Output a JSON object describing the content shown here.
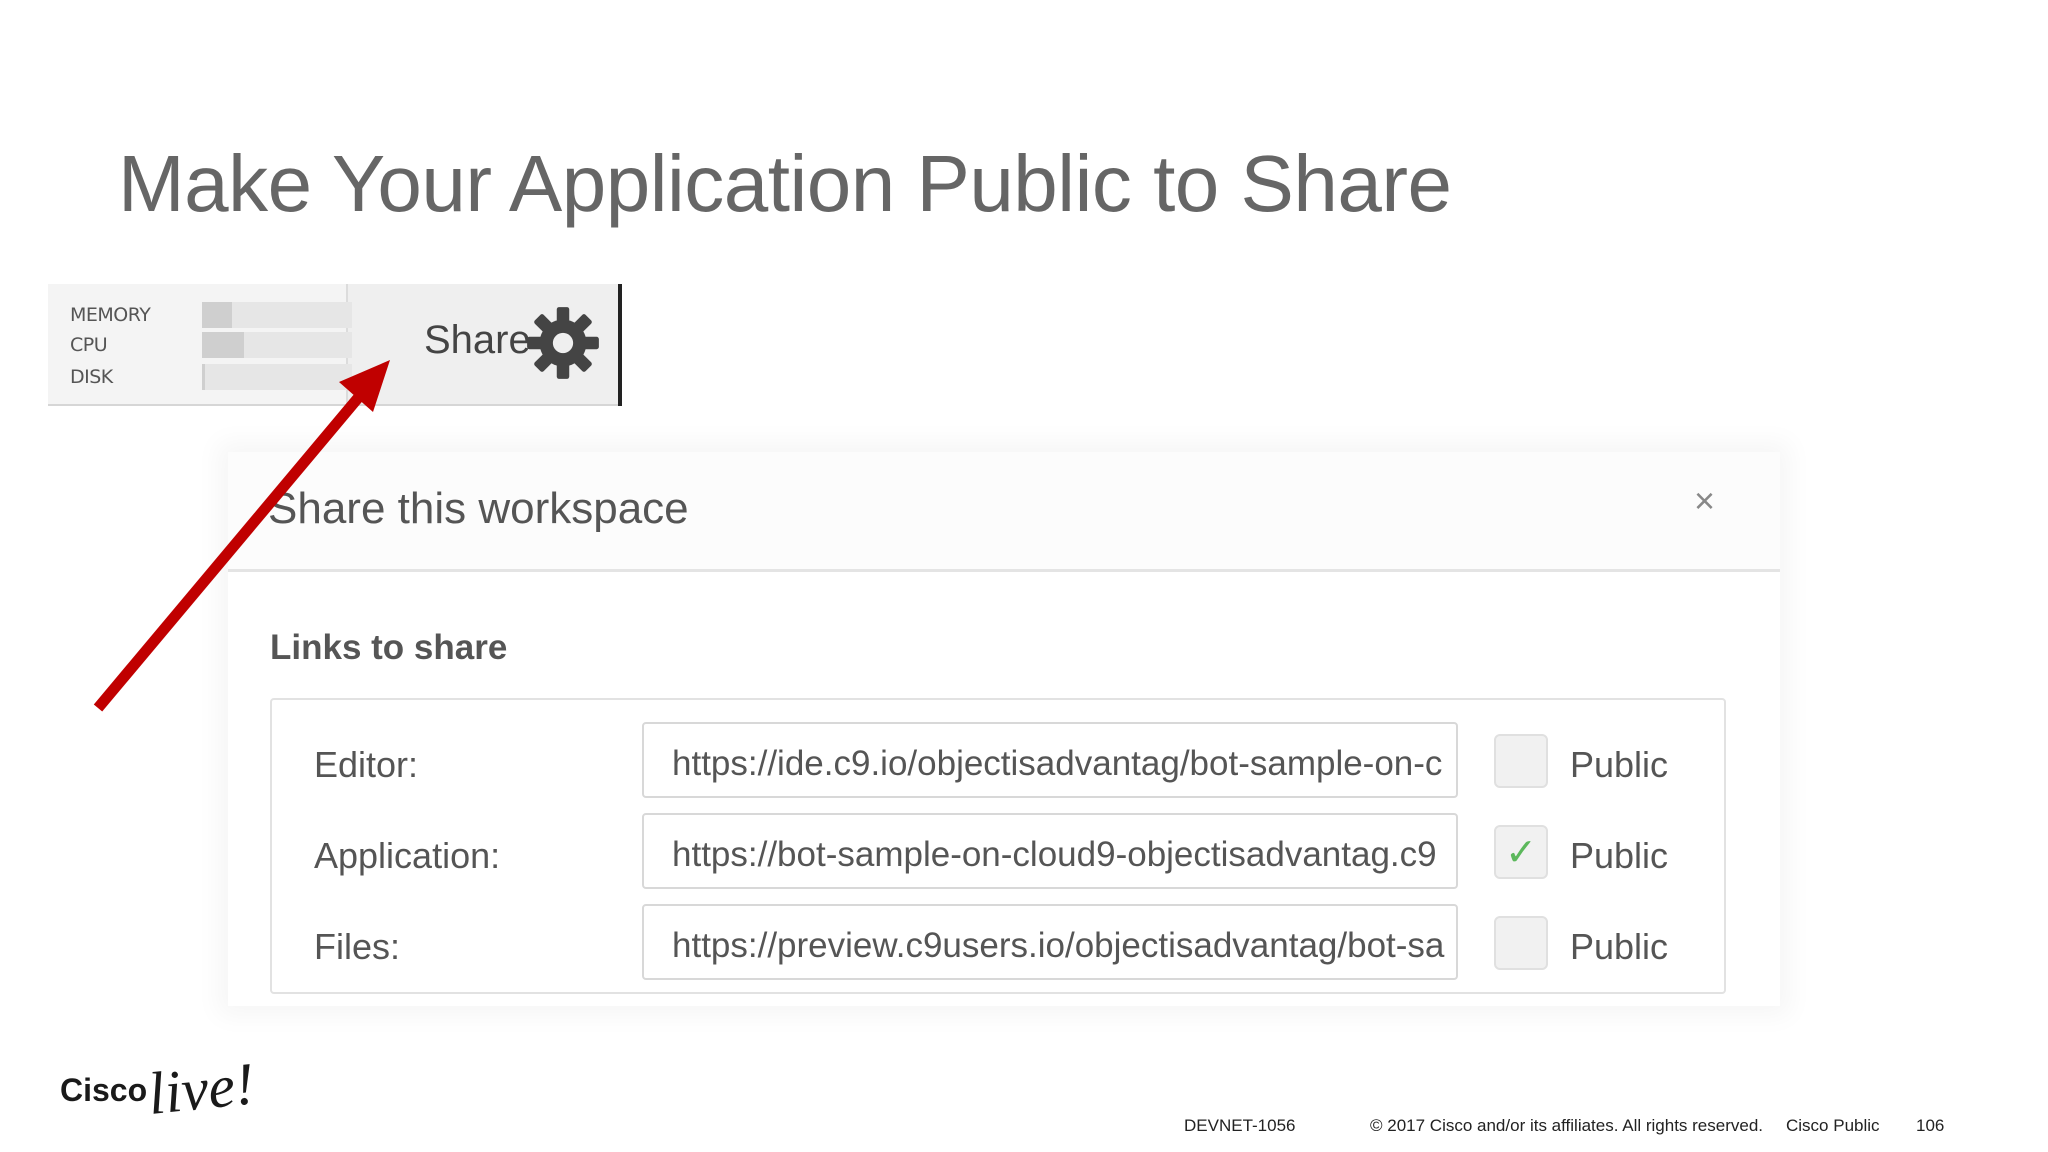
{
  "slide": {
    "title": "Make Your Application Public to Share"
  },
  "toolbar": {
    "stats": [
      {
        "label": "MEMORY",
        "fill_percent": 20
      },
      {
        "label": "CPU",
        "fill_percent": 28
      },
      {
        "label": "DISK",
        "fill_percent": 2
      }
    ],
    "share_label": "Share",
    "settings_icon": "gear-icon"
  },
  "dialog": {
    "title": "Share this workspace",
    "close_glyph": "×",
    "section_label": "Links to share",
    "links": [
      {
        "label": "Editor:",
        "url": "https://ide.c9.io/objectisadvantag/bot-sample-on-c",
        "checked": false,
        "public_label": "Public"
      },
      {
        "label": "Application:",
        "url": "https://bot-sample-on-cloud9-objectisadvantag.c9",
        "checked": true,
        "public_label": "Public"
      },
      {
        "label": "Files:",
        "url": "https://preview.c9users.io/objectisadvantag/bot-sa",
        "checked": false,
        "public_label": "Public"
      }
    ]
  },
  "annotation": {
    "arrow_color": "#c00000"
  },
  "footer": {
    "cisco": "Cisco",
    "live": "live!",
    "session": "DEVNET-1056",
    "copyright": "© 2017  Cisco and/or its affiliates. All rights reserved.",
    "classification": "Cisco Public",
    "page_number": "106"
  }
}
